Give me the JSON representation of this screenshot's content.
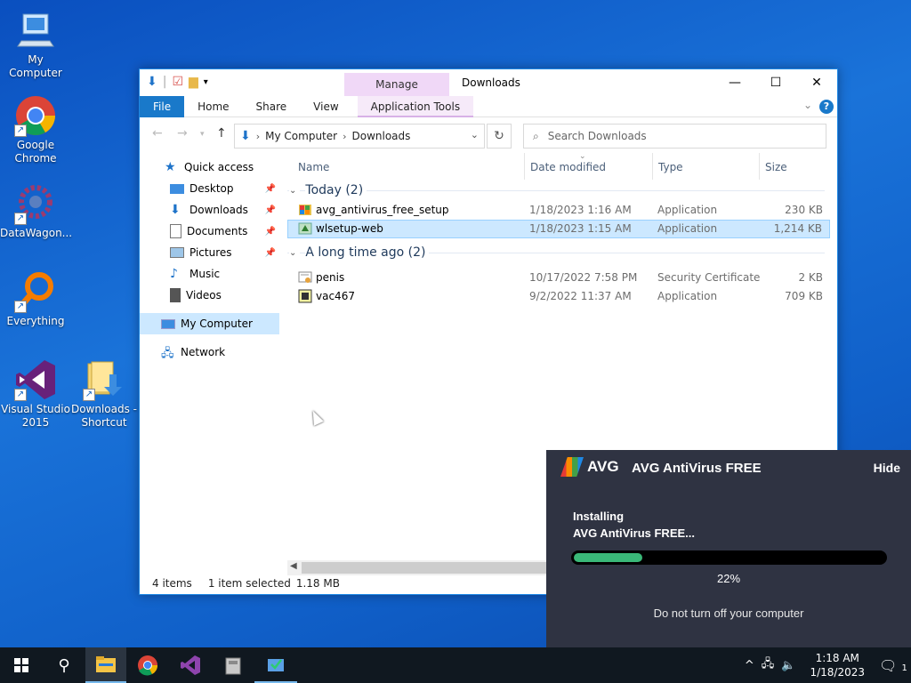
{
  "desktop": {
    "icons": [
      {
        "label": "My Computer"
      },
      {
        "label": "Google Chrome"
      },
      {
        "label": "DataWagon..."
      },
      {
        "label": "Everything"
      },
      {
        "label": "Visual Studio 2015"
      },
      {
        "label": "Downloads - Shortcut"
      }
    ]
  },
  "explorer": {
    "title": "Downloads",
    "manage_tab": "Manage",
    "ribbon_tabs": [
      "File",
      "Home",
      "Share",
      "View",
      "Application Tools"
    ],
    "address": {
      "root": "My Computer",
      "current": "Downloads"
    },
    "search_placeholder": "Search Downloads",
    "nav": {
      "quick_access": "Quick access",
      "items": [
        "Desktop",
        "Downloads",
        "Documents",
        "Pictures",
        "Music",
        "Videos"
      ],
      "my_computer": "My Computer",
      "network": "Network"
    },
    "columns": {
      "name": "Name",
      "date": "Date modified",
      "type": "Type",
      "size": "Size"
    },
    "groups": [
      {
        "label": "Today (2)",
        "files": [
          {
            "name": "avg_antivirus_free_setup",
            "date": "1/18/2023 1:16 AM",
            "type": "Application",
            "size": "230 KB"
          },
          {
            "name": "wlsetup-web",
            "date": "1/18/2023 1:15 AM",
            "type": "Application",
            "size": "1,214 KB"
          }
        ]
      },
      {
        "label": "A long time ago (2)",
        "files": [
          {
            "name": "penis",
            "date": "10/17/2022 7:58 PM",
            "type": "Security Certificate",
            "size": "2 KB"
          },
          {
            "name": "vac467",
            "date": "9/2/2022 11:37 AM",
            "type": "Application",
            "size": "709 KB"
          }
        ]
      }
    ],
    "status": {
      "count": "4 items",
      "selected": "1 item selected",
      "size": "1.18 MB"
    }
  },
  "avg_popup": {
    "logo_text": "AVG",
    "title": "AVG AntiVirus FREE",
    "hide": "Hide",
    "installing_line1": "Installing",
    "installing_line2": "AVG AntiVirus FREE...",
    "progress_fraction": 0.22,
    "progress_text": "22%",
    "warning": "Do not turn off your computer",
    "accent_color": "#3ab878"
  },
  "taskbar": {
    "time": "1:18 AM",
    "date": "1/18/2023",
    "notification_count": "1"
  }
}
